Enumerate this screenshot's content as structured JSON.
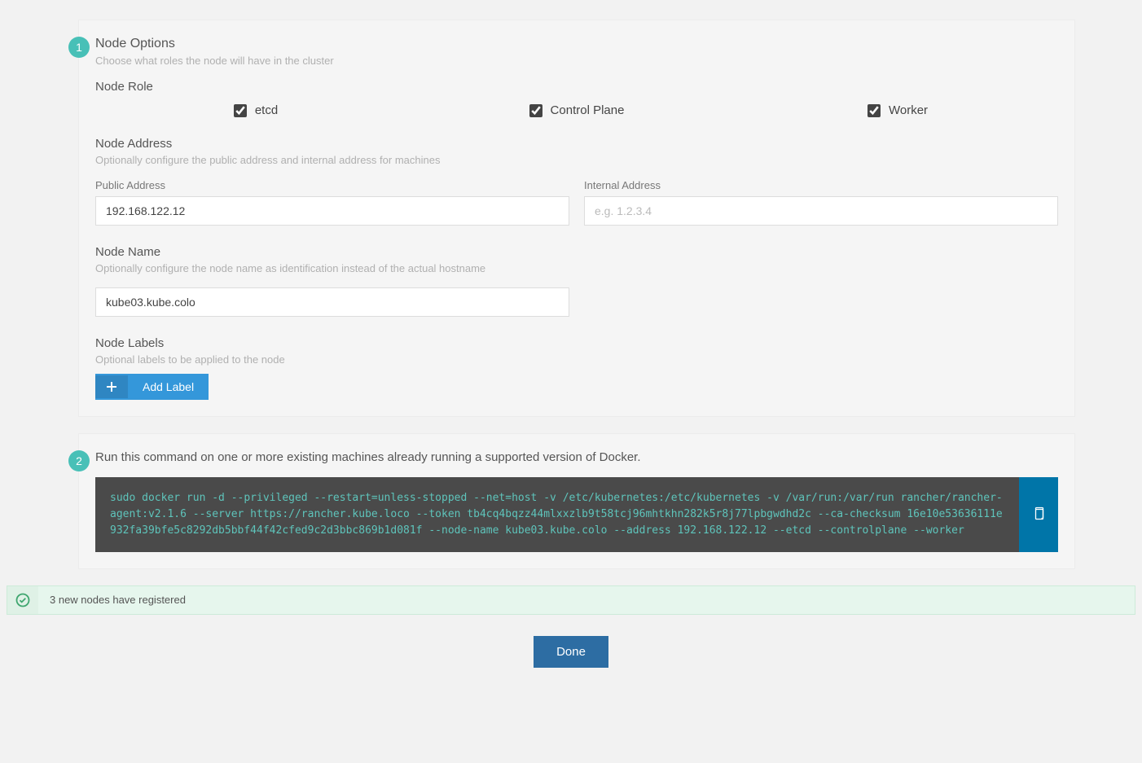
{
  "step1": {
    "badge": "1",
    "title": "Node Options",
    "desc": "Choose what roles the node will have in the cluster",
    "nodeRole": {
      "title": "Node Role",
      "etcd": "etcd",
      "controlPlane": "Control Plane",
      "worker": "Worker"
    },
    "nodeAddress": {
      "title": "Node Address",
      "desc": "Optionally configure the public address and internal address for machines",
      "publicLabel": "Public Address",
      "publicValue": "192.168.122.12",
      "internalLabel": "Internal Address",
      "internalPlaceholder": "e.g. 1.2.3.4"
    },
    "nodeName": {
      "title": "Node Name",
      "desc": "Optionally configure the node name as identification instead of the actual hostname",
      "value": "kube03.kube.colo"
    },
    "nodeLabels": {
      "title": "Node Labels",
      "desc": "Optional labels to be applied to the node",
      "addLabel": "Add Label"
    }
  },
  "step2": {
    "badge": "2",
    "instruction": "Run this command on one or more existing machines already running a supported version of Docker.",
    "command": "sudo docker run -d --privileged --restart=unless-stopped --net=host -v /etc/kubernetes:/etc/kubernetes -v /var/run:/var/run rancher/rancher-agent:v2.1.6 --server https://rancher.kube.loco --token tb4cq4bqzz44mlxxzlb9t58tcj96mhtkhn282k5r8j77lpbgwdhd2c --ca-checksum 16e10e53636111e932fa39bfe5c8292db5bbf44f42cfed9c2d3bbc869b1d081f --node-name kube03.kube.colo --address 192.168.122.12 --etcd --controlplane --worker"
  },
  "status": {
    "text": "3 new nodes have registered"
  },
  "done": "Done"
}
